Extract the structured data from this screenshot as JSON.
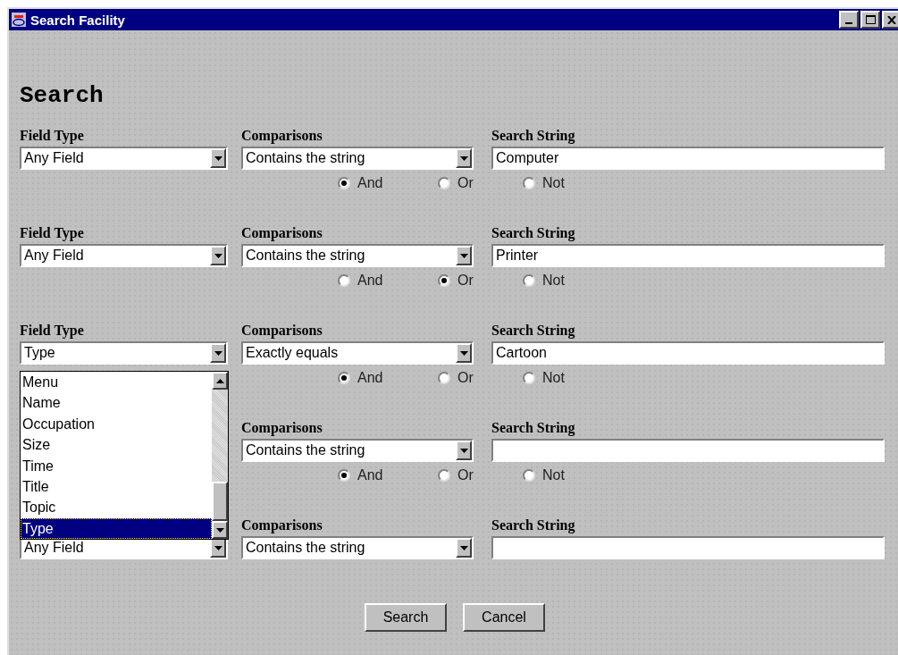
{
  "window": {
    "title": "Search Facility"
  },
  "heading": "Search",
  "criteria": [
    {
      "field_type_label": "Field Type",
      "field_type": "Any Field",
      "comparisons_label": "Comparisons",
      "comparison": "Contains the string",
      "search_string_label": "Search String",
      "search_string": "Computer",
      "operators": [
        {
          "label": "And",
          "selected": true
        },
        {
          "label": "Or",
          "selected": false
        },
        {
          "label": "Not",
          "selected": false
        }
      ]
    },
    {
      "field_type_label": "Field Type",
      "field_type": "Any Field",
      "comparisons_label": "Comparisons",
      "comparison": "Contains the string",
      "search_string_label": "Search String",
      "search_string": "Printer",
      "operators": [
        {
          "label": "And",
          "selected": false
        },
        {
          "label": "Or",
          "selected": true
        },
        {
          "label": "Not",
          "selected": false
        }
      ]
    },
    {
      "field_type_label": "Field Type",
      "field_type": "Type",
      "comparisons_label": "Comparisons",
      "comparison": "Exactly equals",
      "search_string_label": "Search String",
      "search_string": "Cartoon",
      "operators": [
        {
          "label": "And",
          "selected": true
        },
        {
          "label": "Or",
          "selected": false
        },
        {
          "label": "Not",
          "selected": false
        }
      ]
    },
    {
      "comparisons_label": "Comparisons",
      "comparison": "Contains the string",
      "search_string_label": "Search String",
      "operators": [
        {
          "label": "And",
          "selected": true
        },
        {
          "label": "Or",
          "selected": false
        },
        {
          "label": "Not",
          "selected": false
        }
      ]
    },
    {
      "field_type": "Any Field",
      "comparisons_label": "Comparisons",
      "comparison": "Contains the string",
      "search_string_label": "Search String"
    }
  ],
  "dropdown_list": {
    "items": [
      {
        "label": "Menu",
        "selected": false
      },
      {
        "label": "Name",
        "selected": false
      },
      {
        "label": "Occupation",
        "selected": false
      },
      {
        "label": "Size",
        "selected": false
      },
      {
        "label": "Time",
        "selected": false
      },
      {
        "label": "Title",
        "selected": false
      },
      {
        "label": "Topic",
        "selected": false
      },
      {
        "label": "Type",
        "selected": true
      }
    ]
  },
  "buttons": [
    "Search",
    "Cancel"
  ]
}
